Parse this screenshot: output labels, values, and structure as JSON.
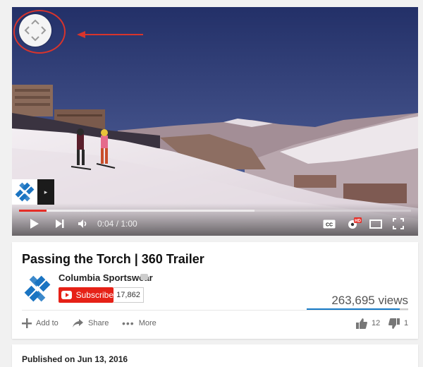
{
  "player": {
    "elapsed": "0:04",
    "separator": " / ",
    "duration": "1:00",
    "played_fraction": 0.07,
    "loaded_fraction": 0.6,
    "nav_icon": "360-pan-control-icon",
    "annotation_arrow_color": "#d8342c"
  },
  "video": {
    "title": "Passing the Torch | 360 Trailer",
    "views": "263,695 views",
    "like_fraction": 0.92,
    "published": "Published on Jun 13, 2016"
  },
  "channel": {
    "name": "Columbia Sportswear",
    "subscribe_label": "Subscribe",
    "subscriber_count": "17,862",
    "brand_color": "#1a74c2"
  },
  "actions": {
    "add_to": "Add to",
    "share": "Share",
    "more": "More",
    "likes": "12",
    "dislikes": "1"
  },
  "colors": {
    "subscribe_red": "#e62117",
    "progress_red": "#e52d27",
    "link_blue": "#167ac6"
  }
}
